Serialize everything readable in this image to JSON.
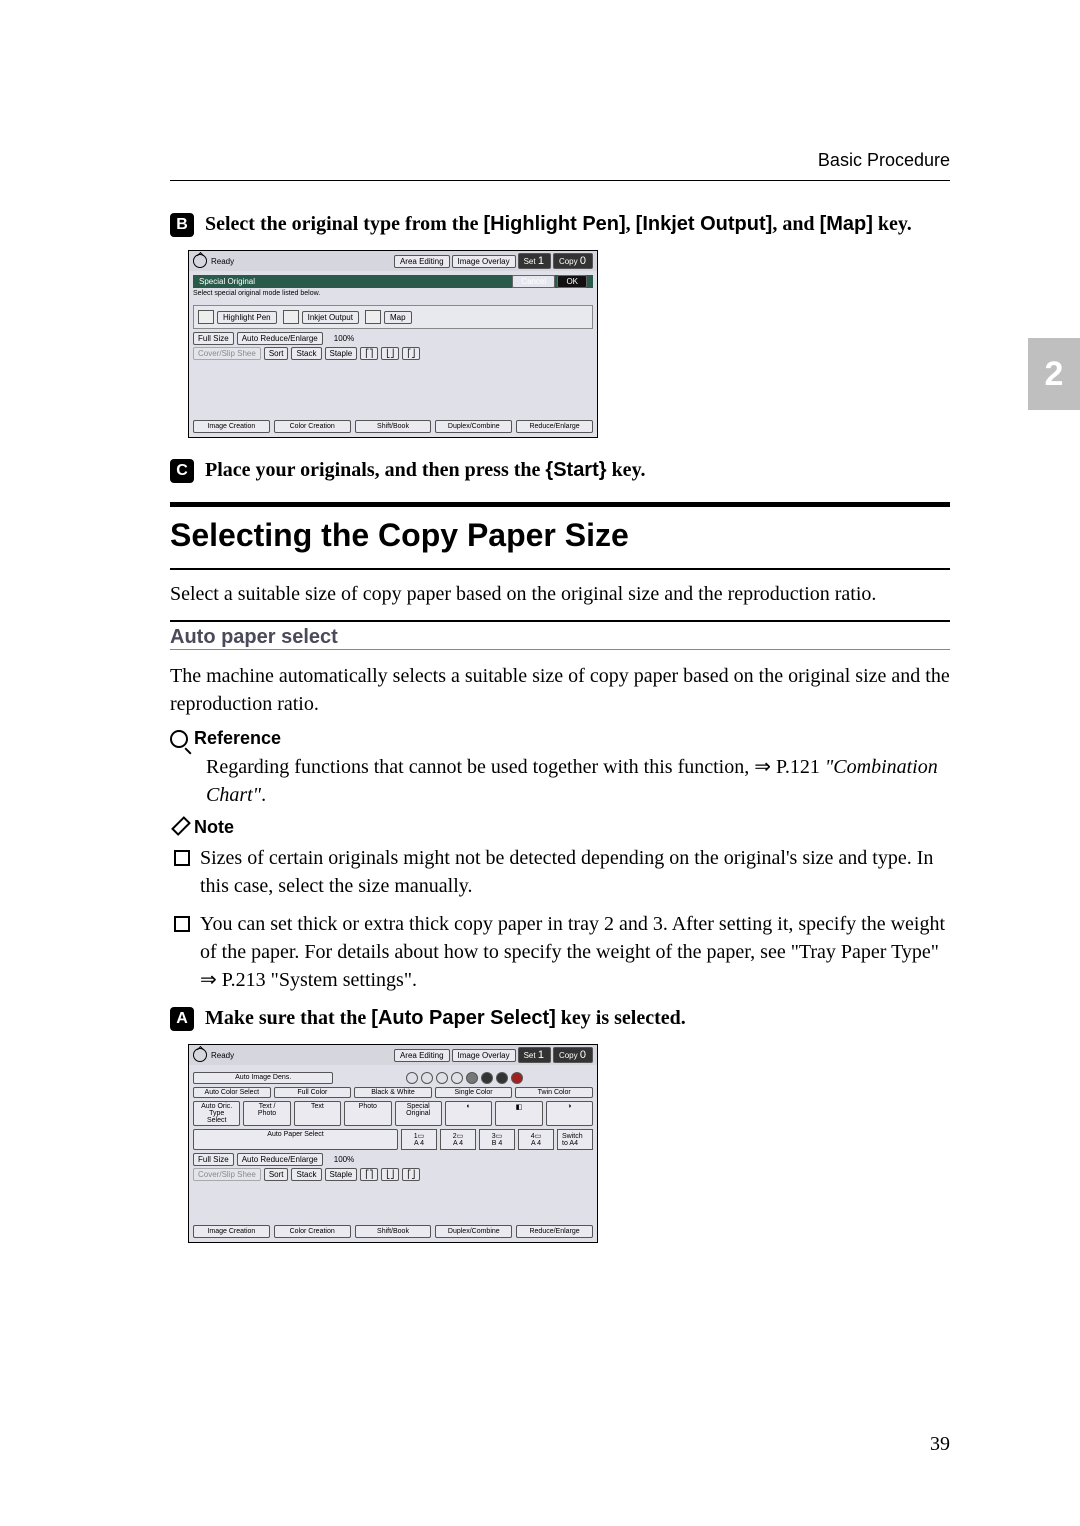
{
  "header": "Basic Procedure",
  "side_tab": "2",
  "step2": {
    "prefix": "Select the original type from the ",
    "key1": "[Highlight Pen]",
    "mid1": ", ",
    "key2": "[Inkjet Output]",
    "mid2": ", and ",
    "key3": "[Map]",
    "suffix": " key."
  },
  "shot1": {
    "ready": "Ready",
    "area_editing": "Area Editing",
    "image_overlay": "Image Overlay",
    "set": "Set",
    "copy": "Copy",
    "counter1": "1",
    "counter0": "0",
    "special_original": "Special Original",
    "cancel": "Cancel",
    "ok": "OK",
    "hint": "Select special original mode listed below.",
    "highlight_pen": "Highlight Pen",
    "inkjet_output": "Inkjet Output",
    "map": "Map",
    "full_size": "Full Size",
    "auto_reduce_enlarge": "Auto Reduce/Enlarge",
    "pct": "100%",
    "sort": "Sort",
    "stack": "Stack",
    "staple": "Staple",
    "tabs": [
      "Image Creation",
      "Color Creation",
      "Shift/Book",
      "Duplex/Combine",
      "Reduce/Enlarge"
    ]
  },
  "step3": {
    "prefix": "Place your originals, and then press the ",
    "key": "{Start}",
    "suffix": " key."
  },
  "h2": "Selecting the Copy Paper Size",
  "para1": "Select a suitable size of copy paper based on the original size and the reproduction ratio.",
  "subhead": "Auto paper select",
  "para2": "The machine automatically selects a suitable size of copy paper based on the original size and the reproduction ratio.",
  "reference_label": "Reference",
  "reference_body_a": "Regarding functions that cannot be used together with this function, ⇒ P.121 ",
  "reference_body_i": "\"Combination Chart\"",
  "reference_body_b": ".",
  "note_label": "Note",
  "notes": [
    "Sizes of certain originals might not be detected depending on the original's size and type. In this case, select the size manually.",
    "You can set thick or extra thick copy paper in tray 2 and 3. After setting it, specify the weight of the paper. For details about how to specify the weight of the paper, see \"Tray Paper Type\" ⇒ P.213 \"System settings\"."
  ],
  "step1b": {
    "prefix": "Make sure that the ",
    "key": "[Auto Paper Select]",
    "suffix": " key is selected."
  },
  "shot2": {
    "ready": "Ready",
    "area_editing": "Area Editing",
    "image_overlay": "Image Overlay",
    "set": "Set",
    "copy": "Copy",
    "counter1": "1",
    "counter0": "0",
    "auto_image_dens": "Auto Image Dens.",
    "auto_color_select": "Auto Color Select",
    "full_color": "Full Color",
    "black_white": "Black & White",
    "single_color": "Single Color",
    "twin_color": "Twin Color",
    "auto_oric_type_select": "Auto Oric. Type Select",
    "text_photo": "Text / Photo",
    "text": "Text",
    "photo": "Photo",
    "special_original": "Special Original",
    "auto_paper_select": "Auto Paper Select",
    "a4": "A 4",
    "b4": "B 4",
    "switch": "Switch to A4",
    "full_size": "Full Size",
    "auto_reduce_enlarge": "Auto Reduce/Enlarge",
    "pct": "100%",
    "sort": "Sort",
    "stack": "Stack",
    "staple": "Staple",
    "tabs": [
      "Image Creation",
      "Color Creation",
      "Shift/Book",
      "Duplex/Combine",
      "Reduce/Enlarge"
    ]
  },
  "pagenum": "39"
}
